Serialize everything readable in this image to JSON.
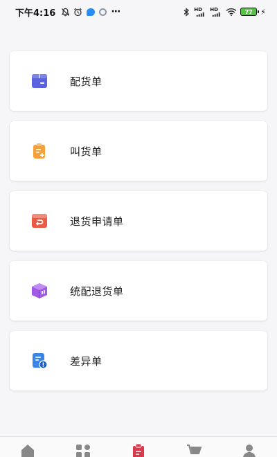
{
  "status_bar": {
    "time": "下午4:16",
    "more": "···",
    "network_left": "HD",
    "network_right": "HD",
    "battery": "77"
  },
  "menu": {
    "items": [
      {
        "id": "delivery",
        "label": "配货单",
        "icon": "delivery-box-icon",
        "color": "#5a63dd"
      },
      {
        "id": "order",
        "label": "叫货单",
        "icon": "order-clipboard-icon",
        "color": "#f5a03b"
      },
      {
        "id": "return-request",
        "label": "退货申请单",
        "icon": "return-request-icon",
        "color": "#ea5a45"
      },
      {
        "id": "unified-return",
        "label": "统配退货单",
        "icon": "unified-return-box-icon",
        "color": "#a05ae6"
      },
      {
        "id": "discrepancy",
        "label": "差异单",
        "icon": "discrepancy-doc-icon",
        "color": "#3a86e8"
      }
    ]
  },
  "tabbar": {
    "tabs": [
      {
        "icon": "home-icon",
        "active": false
      },
      {
        "icon": "apps-icon",
        "active": false
      },
      {
        "icon": "orders-icon",
        "active": true
      },
      {
        "icon": "cart-icon",
        "active": false
      },
      {
        "icon": "user-icon",
        "active": false
      }
    ],
    "active_color": "#d9394a",
    "inactive_color": "#888888"
  }
}
